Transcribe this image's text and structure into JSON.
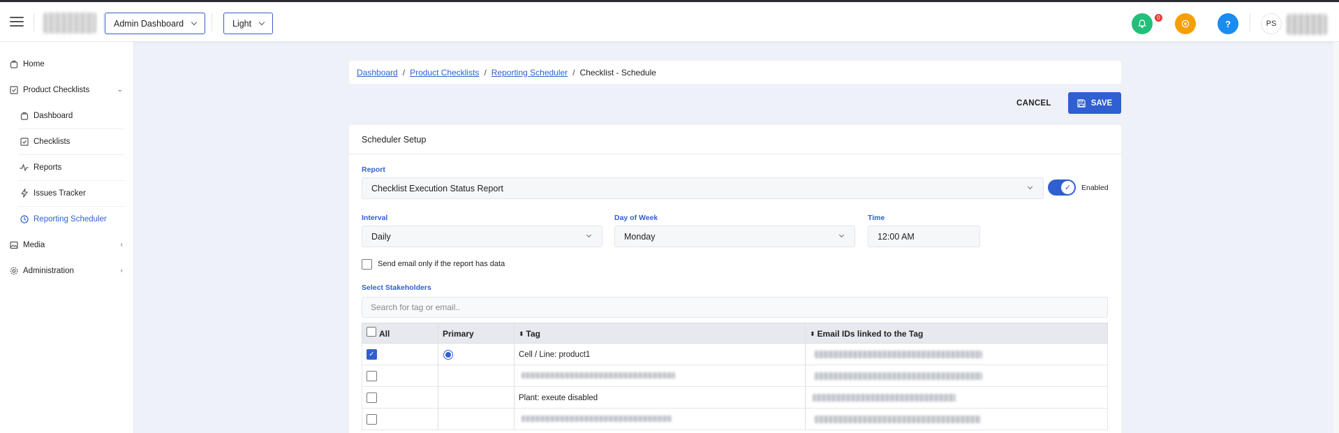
{
  "header": {
    "dashboard_select": "Admin Dashboard",
    "theme_select": "Light",
    "notification_count": "0",
    "help_label": "?",
    "user_initials": "PS"
  },
  "sidebar": {
    "items": [
      {
        "label": "Home",
        "icon": "home-icon"
      },
      {
        "label": "Product Checklists",
        "icon": "checklist-icon",
        "expanded": true
      },
      {
        "label": "Dashboard",
        "icon": "dashboard-icon"
      },
      {
        "label": "Checklists",
        "icon": "checklists-icon"
      },
      {
        "label": "Reports",
        "icon": "reports-icon"
      },
      {
        "label": "Issues Tracker",
        "icon": "issues-icon"
      },
      {
        "label": "Reporting Scheduler",
        "icon": "clock-icon",
        "active": true
      },
      {
        "label": "Media",
        "icon": "media-icon"
      },
      {
        "label": "Administration",
        "icon": "gear-icon"
      }
    ]
  },
  "breadcrumb": {
    "items": [
      "Dashboard",
      "Product Checklists",
      "Reporting Scheduler"
    ],
    "current": "Checklist - Schedule"
  },
  "actions": {
    "cancel": "CANCEL",
    "save": "SAVE"
  },
  "form": {
    "title": "Scheduler Setup",
    "report_label": "Report",
    "report_value": "Checklist Execution Status Report",
    "enabled_label": "Enabled",
    "enabled": true,
    "interval_label": "Interval",
    "interval_value": "Daily",
    "day_label": "Day of Week",
    "day_value": "Monday",
    "time_label": "Time",
    "time_value": "12:00 AM",
    "send_only_data_label": "Send email only if the report has data",
    "stakeholders_label": "Select Stakeholders",
    "search_placeholder": "Search for tag or email.."
  },
  "table": {
    "headers": {
      "all": "All",
      "primary": "Primary",
      "tag": "Tag",
      "email": "Email IDs linked to the Tag"
    },
    "rows": [
      {
        "checked": true,
        "primary": true,
        "tag": "Cell / Line: product1"
      },
      {
        "checked": false,
        "primary": false,
        "tag": ""
      },
      {
        "checked": false,
        "primary": false,
        "tag": "Plant: exeute disabled"
      },
      {
        "checked": false,
        "primary": false,
        "tag": ""
      }
    ]
  },
  "colors": {
    "accent": "#2f5fd0",
    "notification": "#21c07a",
    "settings": "#f5a000",
    "help": "#1a8cf0"
  }
}
